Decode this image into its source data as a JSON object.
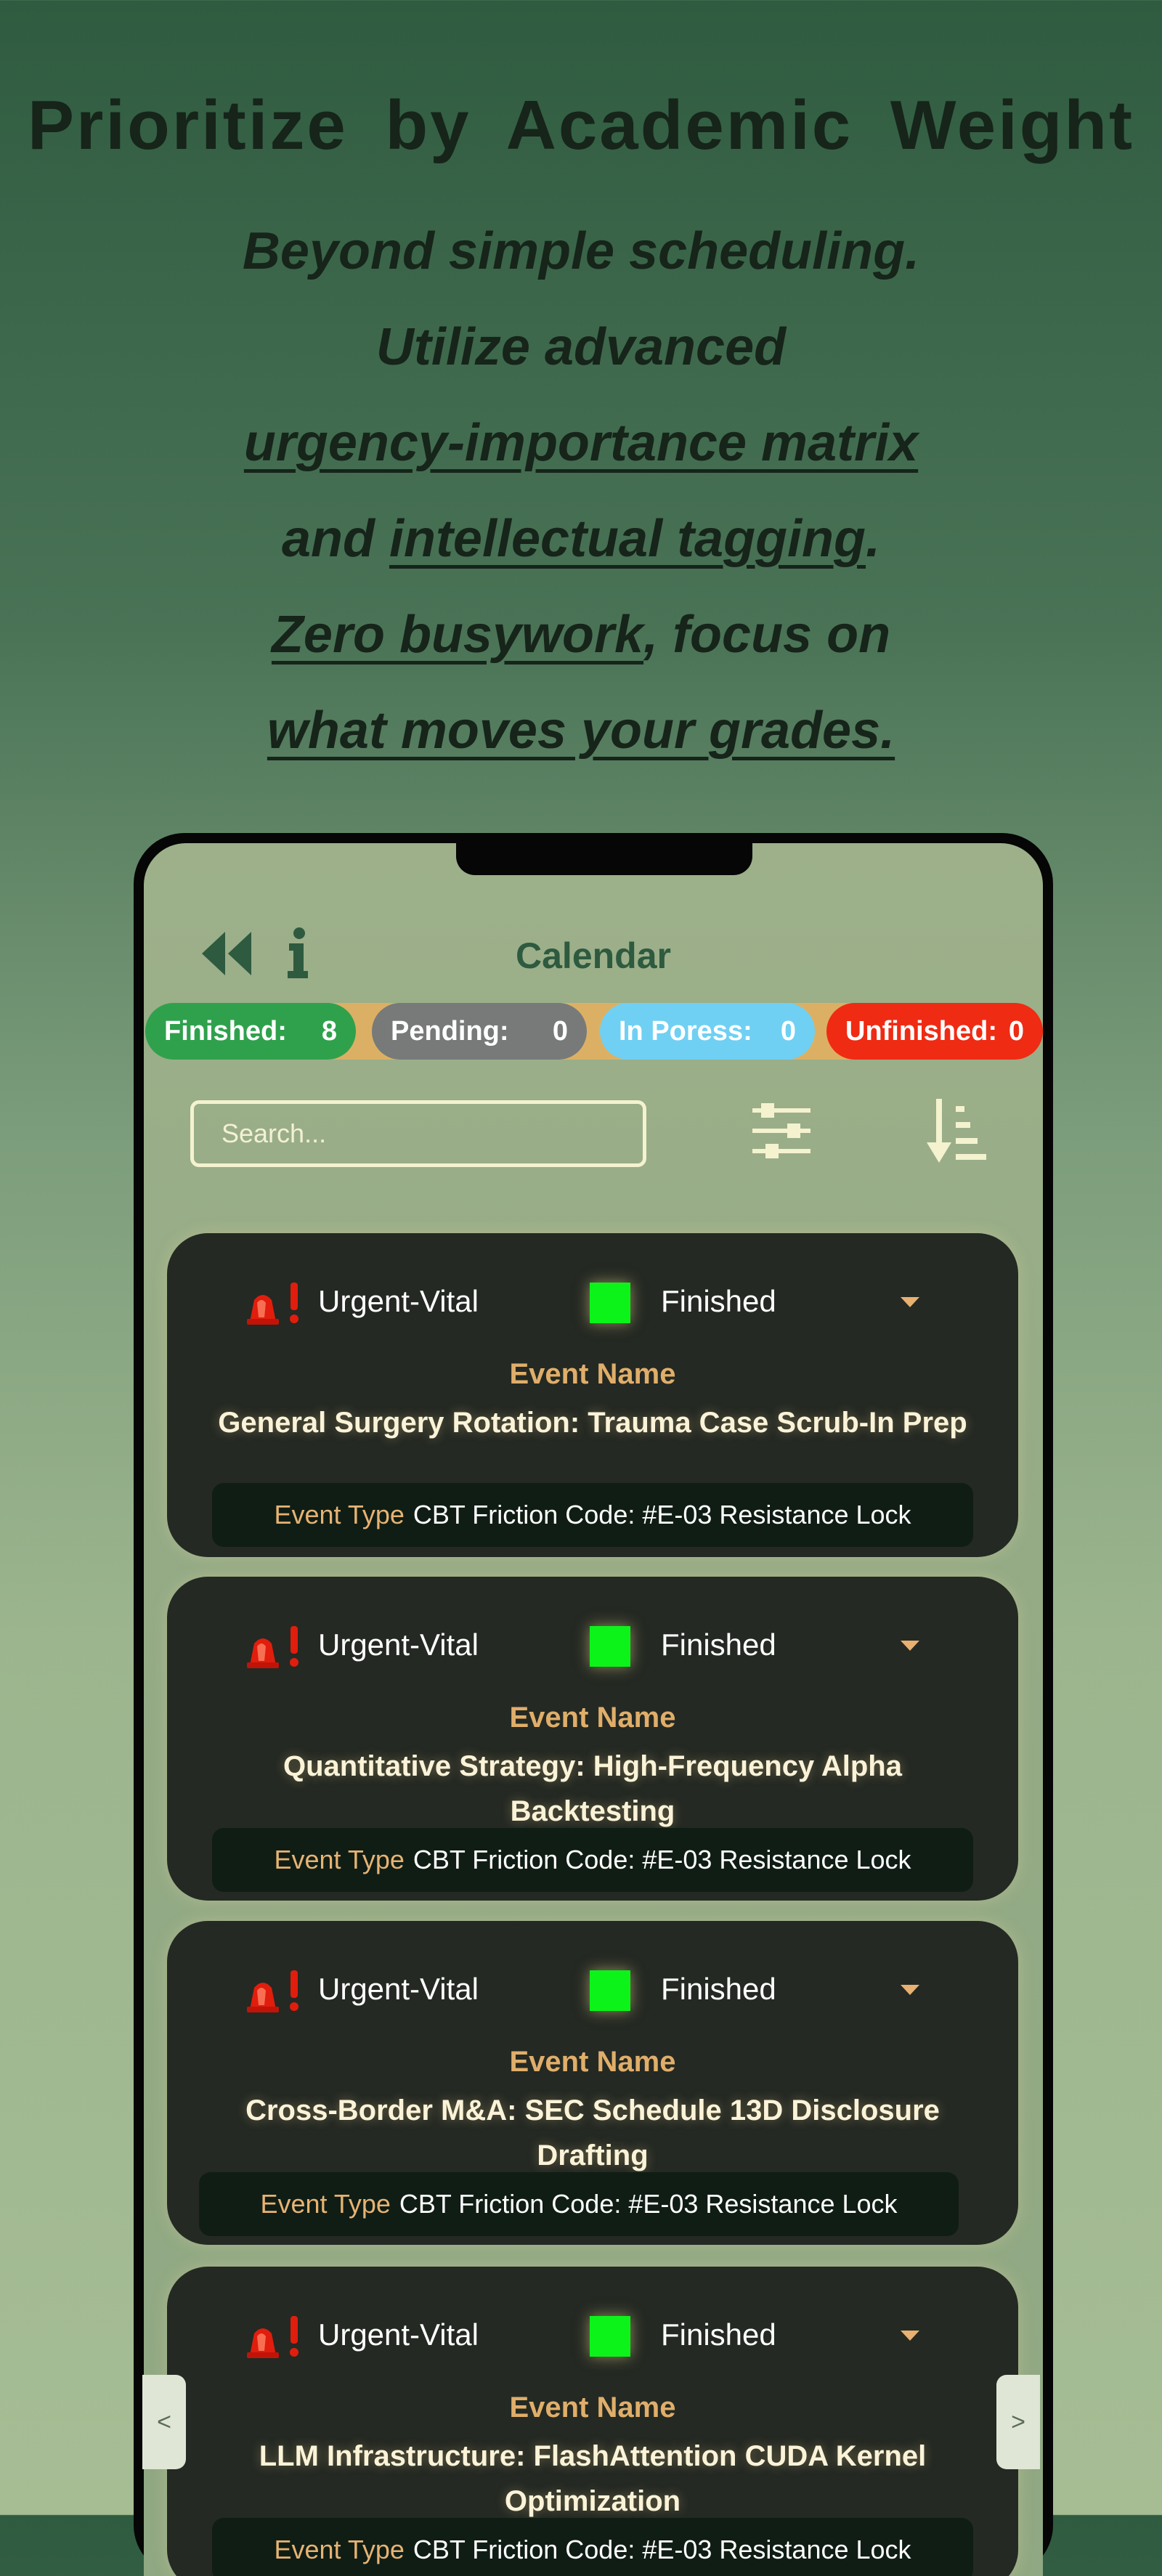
{
  "headline": "Prioritize by Academic Weight",
  "tagline": {
    "l1": "Beyond simple scheduling.",
    "l2": "Utilize advanced",
    "l3": "urgency-importance matrix",
    "l4a": "and ",
    "l4b": "intellectual tagging",
    "l4c": ".",
    "l5a": "Zero busywork",
    "l5b": ", focus on",
    "l6": "what moves your grades."
  },
  "app": {
    "title": "Calendar",
    "back_icon": "double-chevron-left-icon",
    "info_icon": "info-icon",
    "filter_icon": "sliders-icon",
    "sort_icon": "sort-descending-icon",
    "search_placeholder": "Search..."
  },
  "stats": [
    {
      "label": "Finished:",
      "value": "8",
      "color": "#2fa14c"
    },
    {
      "label": "Pending:",
      "value": "0",
      "color": "#777a79"
    },
    {
      "label": "In Poress:",
      "value": "0",
      "color": "#6fd0f3"
    },
    {
      "label": "Unfinished:",
      "value": "0",
      "color": "#ef2b14"
    }
  ],
  "event_label": "Event Name",
  "type_label": "Event Type",
  "events": [
    {
      "priority": "Urgent-Vital",
      "status": "Finished",
      "name": "General Surgery Rotation: Trauma Case Scrub-In Prep",
      "type": "CBT Friction Code: #E-03 Resistance Lock"
    },
    {
      "priority": "Urgent-Vital",
      "status": "Finished",
      "name": "Quantitative Strategy: High-Frequency Alpha Backtesting",
      "type": "CBT Friction Code: #E-03 Resistance Lock"
    },
    {
      "priority": "Urgent-Vital",
      "status": "Finished",
      "name": "Cross-Border M&A: SEC Schedule 13D Disclosure Drafting",
      "type": "CBT Friction Code: #E-03 Resistance Lock"
    },
    {
      "priority": "Urgent-Vital",
      "status": "Finished",
      "name": "LLM Infrastructure: FlashAttention CUDA Kernel Optimization",
      "type": "CBT Friction Code: #E-03 Resistance Lock"
    }
  ],
  "colors": {
    "status_finished": "#0cf31a",
    "accent": "#e0ae6a",
    "card_bg": "#242923"
  },
  "nav": {
    "prev": "<",
    "next": ">"
  }
}
